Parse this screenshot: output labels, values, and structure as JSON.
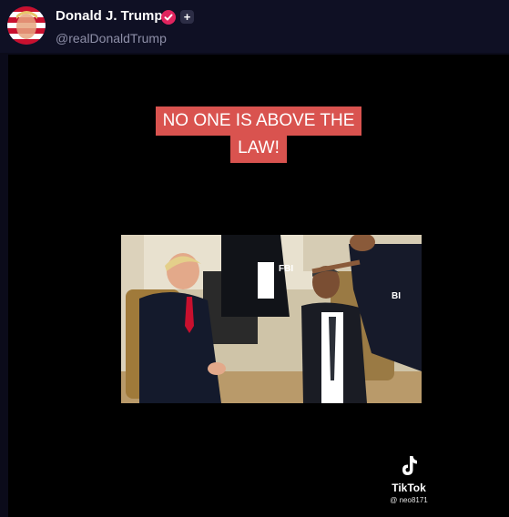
{
  "post": {
    "author_name": "Donald J. Trump",
    "author_handle": "@realDonaldTrump",
    "verified_icon": "verified-badge-icon",
    "follow_icon": "plus-icon",
    "follow_symbol": "+"
  },
  "video": {
    "caption_line1": "NO ONE IS ABOVE THE",
    "caption_line2": "LAW!",
    "photo_label": "FBI",
    "tiktok_label": "TikTok",
    "tiktok_user": "@ neo8171"
  },
  "colors": {
    "header_bg": "#0f1024",
    "caption_bg": "#d9534f",
    "verified": "#e0245e"
  }
}
